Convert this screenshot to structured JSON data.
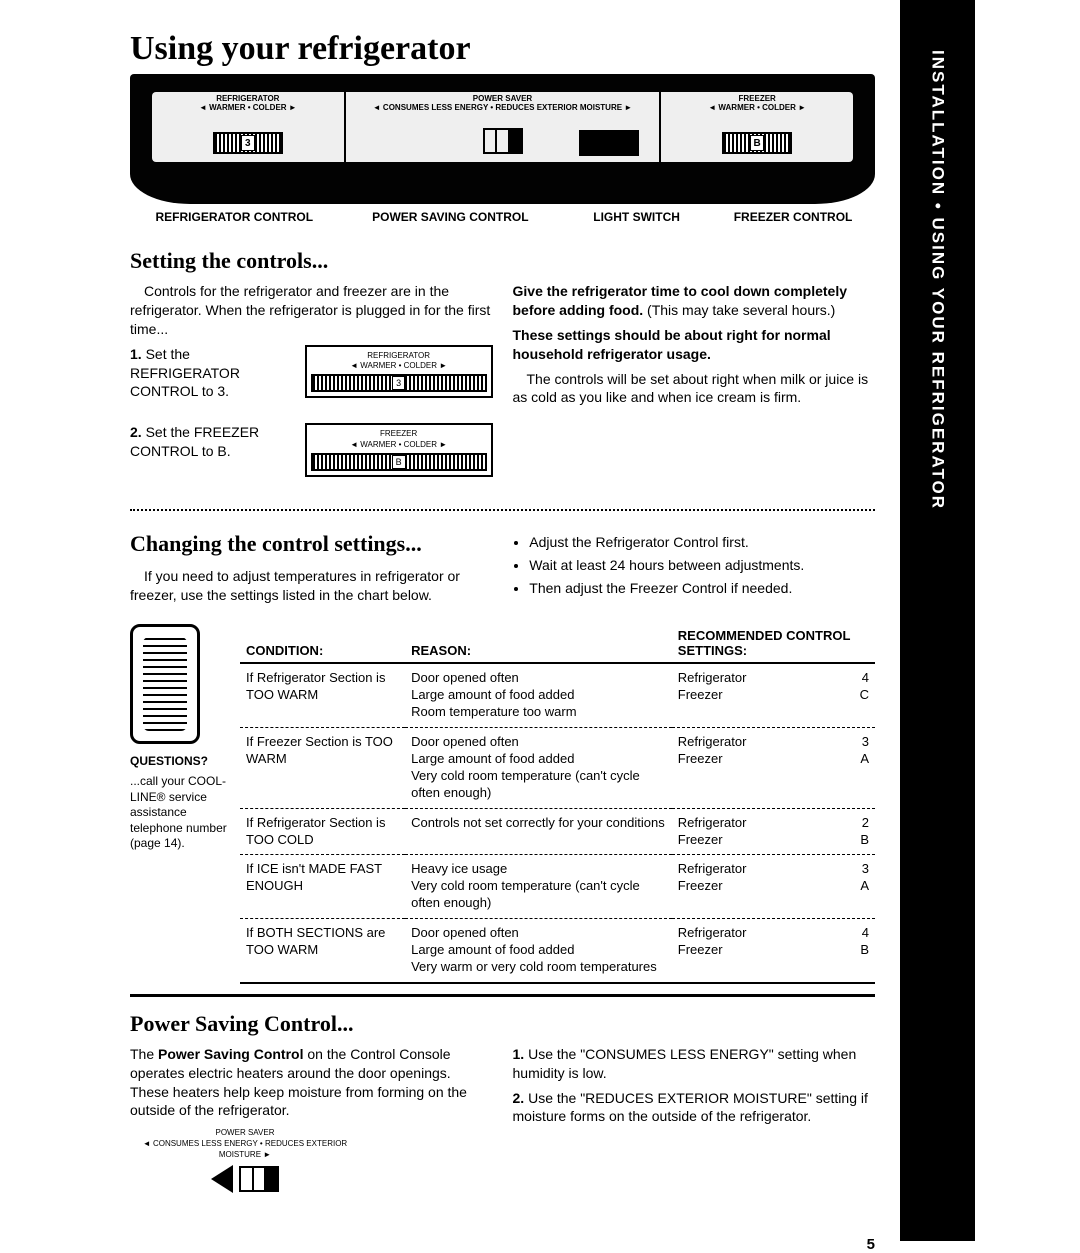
{
  "sideTab": "INSTALLATION • USING YOUR REFRIGERATOR",
  "title": "Using your refrigerator",
  "console": {
    "refrigerator": {
      "top": "REFRIGERATOR",
      "range": "◄ WARMER • COLDER ►",
      "value": "3"
    },
    "powersaver": {
      "top": "POWER  SAVER",
      "range": "◄ CONSUMES  LESS  ENERGY  •  REDUCES  EXTERIOR  MOISTURE ►"
    },
    "freezer": {
      "top": "FREEZER",
      "range": "◄ WARMER • COLDER ►",
      "value": "B"
    }
  },
  "consoleLabels": {
    "refrigerator": "REFRIGERATOR CONTROL",
    "power": "POWER SAVING CONTROL",
    "light": "LIGHT SWITCH",
    "freezer": "FREEZER CONTROL"
  },
  "setting": {
    "heading": "Setting the controls...",
    "intro": "Controls for the refrigerator and freezer are in the refrigerator. When the refrigerator is plugged in for the first time...",
    "step1num": "1.",
    "step1": "Set the REFRIGERATOR CONTROL to 3.",
    "step2num": "2.",
    "step2": "Set the FREEZER CONTROL to B.",
    "miniRefrig": {
      "top": "REFRIGERATOR",
      "range": "◄ WARMER • COLDER ►",
      "value": "3"
    },
    "miniFreezer": {
      "top": "FREEZER",
      "range": "◄ WARMER • COLDER ►",
      "value": "B"
    },
    "right1bold": "Give the refrigerator time to cool down completely before adding food.",
    "right1rest": " (This may take several hours.)",
    "right2bold": "These settings should be about right for normal household refrigerator usage.",
    "right3": "The controls will be set about right when milk or juice is as cold as you like and when ice cream is firm."
  },
  "changing": {
    "heading": "Changing the control settings...",
    "leftIntro": "If you need to adjust temperatures in refrigerator or freezer, use the settings listed in the chart below.",
    "bullets": [
      "Adjust the Refrigerator Control first.",
      "Wait at least 24 hours between adjustments.",
      "Then adjust the Freezer Control if needed."
    ],
    "aside": {
      "q": "QUESTIONS?",
      "text": "...call your COOL-LINE® service assistance telephone number (page 14)."
    }
  },
  "chart_data": {
    "type": "table",
    "title": "Recommended control settings chart",
    "headers": [
      "CONDITION:",
      "REASON:",
      "RECOMMENDED CONTROL SETTINGS:"
    ],
    "rows": [
      {
        "condition": "If Refrigerator Section is TOO WARM",
        "reason": "Door opened often\nLarge amount of food added\nRoom temperature too warm",
        "rec": {
          "Refrigerator": "4",
          "Freezer": "C"
        }
      },
      {
        "condition": "If Freezer Section is TOO WARM",
        "reason": "Door opened often\nLarge amount of food added\nVery cold room temperature (can't cycle often enough)",
        "rec": {
          "Refrigerator": "3",
          "Freezer": "A"
        }
      },
      {
        "condition": "If Refrigerator Section is TOO COLD",
        "reason": "Controls not set correctly for your conditions",
        "rec": {
          "Refrigerator": "2",
          "Freezer": "B"
        }
      },
      {
        "condition": "If ICE isn't MADE FAST ENOUGH",
        "reason": "Heavy ice usage\nVery cold room temperature (can't cycle often enough)",
        "rec": {
          "Refrigerator": "3",
          "Freezer": "A"
        }
      },
      {
        "condition": "If BOTH SECTIONS are TOO WARM",
        "reason": "Door opened often\nLarge amount of food added\nVery warm or very cold room temperatures",
        "rec": {
          "Refrigerator": "4",
          "Freezer": "B"
        }
      }
    ]
  },
  "power": {
    "heading": "Power Saving Control...",
    "leftPre": "The ",
    "leftBold": "Power Saving Control",
    "leftPost": " on the Control Console operates electric heaters around the door openings. These heaters help keep moisture from forming on the outside of the refrigerator.",
    "diag": {
      "top": "POWER  SAVER",
      "range": "◄ CONSUMES  LESS  ENERGY  •  REDUCES  EXTERIOR  MOISTURE ►"
    },
    "r1num": "1.",
    "r1": "Use the \"CONSUMES LESS ENERGY\" setting when humidity is low.",
    "r2num": "2.",
    "r2": "Use the \"REDUCES EXTERIOR MOISTURE\" setting if moisture forms on the outside of the refrigerator."
  },
  "pageNumber": "5"
}
